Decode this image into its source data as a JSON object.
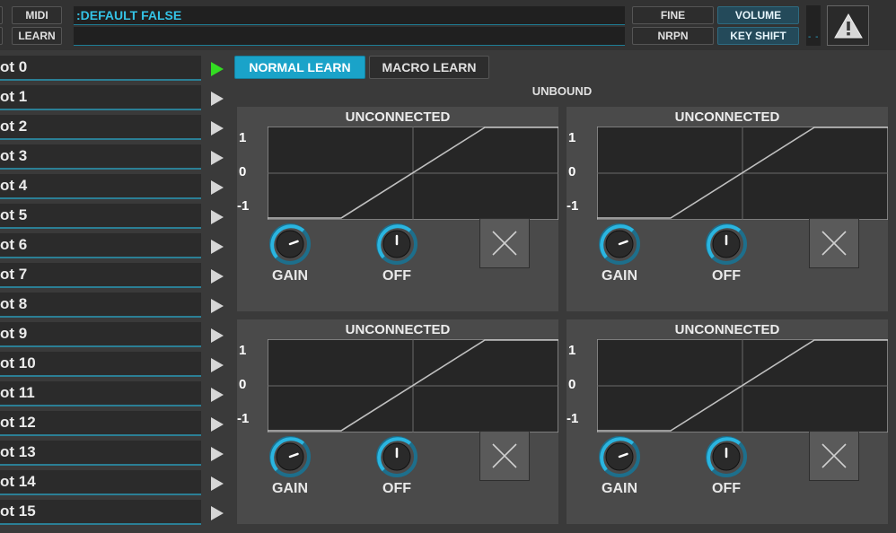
{
  "top": {
    "midi_label": "MIDI",
    "learn_label": "LEARN",
    "display_line1": ":DEFAULT FALSE",
    "display_line2": "",
    "fine_label": "FINE",
    "nrpn_label": "NRPN",
    "volume_label": "VOLUME",
    "keyshift_label": "KEY SHIFT",
    "meter_text": "- -"
  },
  "slots": [
    "ot 0",
    "ot 1",
    "ot 2",
    "ot 3",
    "ot 4",
    "ot 5",
    "ot 6",
    "ot 7",
    "ot 8",
    "ot 9",
    "ot 10",
    "ot 11",
    "ot 12",
    "ot 13",
    "ot 14",
    "ot 15"
  ],
  "active_slot": 0,
  "learn": {
    "normal": "NORMAL LEARN",
    "macro": "MACRO LEARN"
  },
  "binding_status": "UNBOUND",
  "panels": [
    {
      "title": "UNCONNECTED",
      "y_top": "1",
      "y_mid": "0",
      "y_bot": "-1",
      "gain_label": "GAIN",
      "off_label": "OFF"
    },
    {
      "title": "UNCONNECTED",
      "y_top": "1",
      "y_mid": "0",
      "y_bot": "-1",
      "gain_label": "GAIN",
      "off_label": "OFF"
    },
    {
      "title": "UNCONNECTED",
      "y_top": "1",
      "y_mid": "0",
      "y_bot": "-1",
      "gain_label": "GAIN",
      "off_label": "OFF"
    },
    {
      "title": "UNCONNECTED",
      "y_top": "1",
      "y_mid": "0",
      "y_bot": "-1",
      "gain_label": "GAIN",
      "off_label": "OFF"
    }
  ],
  "colors": {
    "accent": "#1aa3c9",
    "active_arrow": "#33dd22",
    "inactive_arrow": "#d6d6d6"
  }
}
